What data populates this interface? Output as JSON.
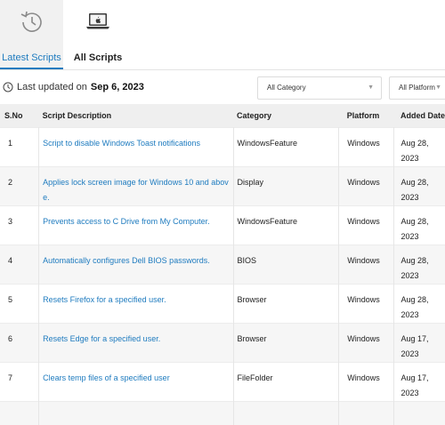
{
  "tabs": [
    {
      "label": "Latest Scripts",
      "icon": "history-icon",
      "active": true
    },
    {
      "label": "All Scripts",
      "icon": "laptop-apple-icon",
      "active": false
    }
  ],
  "update": {
    "prefix": "Last updated on",
    "date": "Sep 6, 2023"
  },
  "filters": {
    "category": "All Category",
    "platform": "All Platform"
  },
  "table": {
    "headers": [
      "S.No",
      "Script Description",
      "Category",
      "Platform",
      "Added Date"
    ],
    "rows": [
      {
        "no": "1",
        "desc_a": "Script to disable Windows Toast notifications",
        "desc_b": "",
        "category": "WindowsFeature",
        "platform": "Windows",
        "date_a": "Aug 28,",
        "date_b": "2023"
      },
      {
        "no": "2",
        "desc_a": "Applies lock screen image for Windows 10 and abov",
        "desc_b": "e.",
        "category": "Display",
        "platform": "Windows",
        "date_a": "Aug 28,",
        "date_b": "2023"
      },
      {
        "no": "3",
        "desc_a": "Prevents access to C Drive from My Computer.",
        "desc_b": "",
        "category": "WindowsFeature",
        "platform": "Windows",
        "date_a": "Aug 28,",
        "date_b": "2023"
      },
      {
        "no": "4",
        "desc_a": "Automatically configures Dell BIOS passwords.",
        "desc_b": "",
        "category": "BIOS",
        "platform": "Windows",
        "date_a": "Aug 28,",
        "date_b": "2023"
      },
      {
        "no": "5",
        "desc_a": "Resets Firefox for a specified user.",
        "desc_b": "",
        "category": "Browser",
        "platform": "Windows",
        "date_a": "Aug 28,",
        "date_b": "2023"
      },
      {
        "no": "6",
        "desc_a": "Resets Edge for a specified user.",
        "desc_b": "",
        "category": "Browser",
        "platform": "Windows",
        "date_a": "Aug 17, 2023",
        "date_b": ""
      },
      {
        "no": "7",
        "desc_a": "Clears temp files of a specified user",
        "desc_b": "",
        "category": "FileFolder",
        "platform": "Windows",
        "date_a": "Aug 17, 2023",
        "date_b": ""
      }
    ]
  }
}
